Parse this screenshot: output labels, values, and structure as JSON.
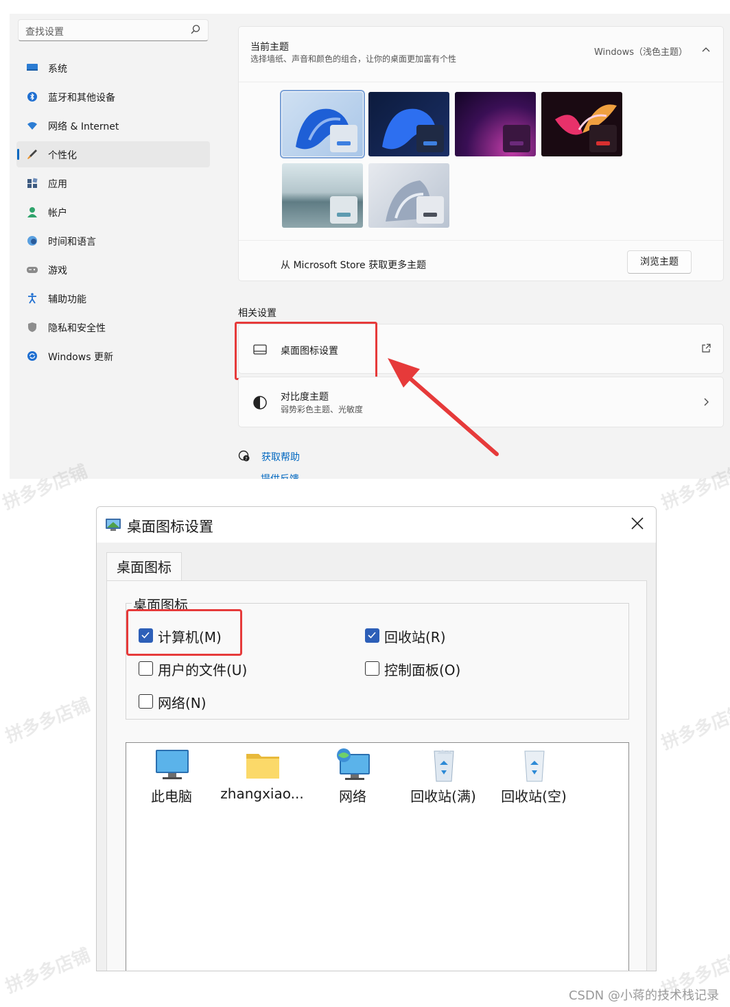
{
  "settings": {
    "search_placeholder": "查找设置",
    "nav": [
      {
        "label": "系统",
        "icon": "monitor-icon"
      },
      {
        "label": "蓝牙和其他设备",
        "icon": "bluetooth-icon"
      },
      {
        "label": "网络 & Internet",
        "icon": "wifi-icon"
      },
      {
        "label": "个性化",
        "icon": "brush-icon",
        "selected": true
      },
      {
        "label": "应用",
        "icon": "apps-icon"
      },
      {
        "label": "帐户",
        "icon": "person-icon"
      },
      {
        "label": "时间和语言",
        "icon": "globe-clock-icon"
      },
      {
        "label": "游戏",
        "icon": "gamepad-icon"
      },
      {
        "label": "辅助功能",
        "icon": "accessibility-icon"
      },
      {
        "label": "隐私和安全性",
        "icon": "shield-icon"
      },
      {
        "label": "Windows 更新",
        "icon": "update-icon"
      }
    ],
    "theme_card": {
      "title": "当前主题",
      "subtitle": "选择墙纸、声音和颜色的组合，让你的桌面更加富有个性",
      "current": "Windows（浅色主题）",
      "store_text": "从 Microsoft Store 获取更多主题",
      "browse_button": "浏览主题"
    },
    "related_heading": "相关设置",
    "desktop_icons_row": {
      "title": "桌面图标设置"
    },
    "contrast_row": {
      "title": "对比度主题",
      "subtitle": "弱势彩色主题、光敏度"
    },
    "help_link": "获取帮助",
    "feedback_link": "提供反馈"
  },
  "dialog": {
    "title": "桌面图标设置",
    "tab": "桌面图标",
    "group_label": "桌面图标",
    "checkboxes": [
      {
        "label": "计算机(M)",
        "checked": true
      },
      {
        "label": "回收站(R)",
        "checked": true
      },
      {
        "label": "用户的文件(U)",
        "checked": false
      },
      {
        "label": "控制面板(O)",
        "checked": false
      },
      {
        "label": "网络(N)",
        "checked": false
      }
    ],
    "icons": [
      {
        "name": "此电脑",
        "icon": "computer-icon"
      },
      {
        "name": "zhangxiao...",
        "icon": "folder-icon"
      },
      {
        "name": "网络",
        "icon": "network-icon"
      },
      {
        "name": "回收站(满)",
        "icon": "recycle-bin-full-icon"
      },
      {
        "name": "回收站(空)",
        "icon": "recycle-bin-empty-icon"
      }
    ]
  },
  "watermark": "拼多多店铺",
  "footer": "CSDN @小蒋的技术栈记录",
  "colors": {
    "accent": "#0067c0",
    "highlight": "#e63a3a",
    "checkbox": "#2d5fb8"
  }
}
